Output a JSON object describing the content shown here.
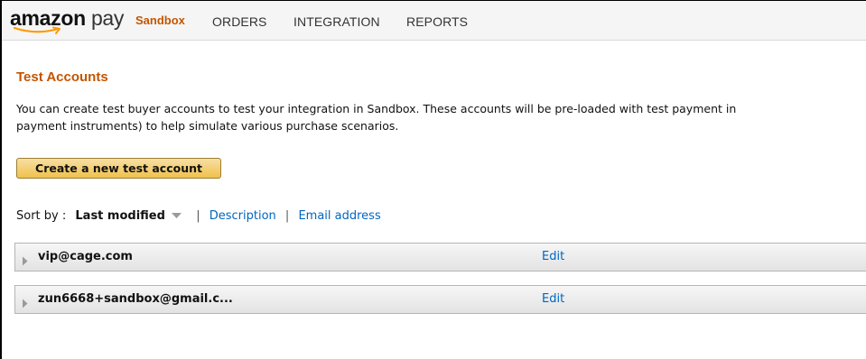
{
  "header": {
    "logo_text_amazon": "amazon",
    "logo_text_pay": "pay",
    "environment_label": "Sandbox",
    "nav": [
      {
        "label": "ORDERS"
      },
      {
        "label": "INTEGRATION"
      },
      {
        "label": "REPORTS"
      }
    ]
  },
  "page": {
    "title": "Test Accounts",
    "description_line1": "You can create test buyer accounts to test your integration in Sandbox. These accounts will be pre-loaded with test payment in",
    "description_line2": "payment instruments) to help simulate various purchase scenarios.",
    "create_button_label": "Create a new test account"
  },
  "sort": {
    "label": "Sort by :",
    "active": "Last modified",
    "options": [
      {
        "label": "Description"
      },
      {
        "label": "Email address"
      }
    ],
    "separator": "|"
  },
  "accounts": [
    {
      "email": "vip@cage.com",
      "edit_label": "Edit"
    },
    {
      "email": "zun6668+sandbox@gmail.c...",
      "edit_label": "Edit"
    }
  ],
  "colors": {
    "accent_orange": "#c45500",
    "link_blue": "#0066c0",
    "button_gold": "#f0c14b"
  }
}
